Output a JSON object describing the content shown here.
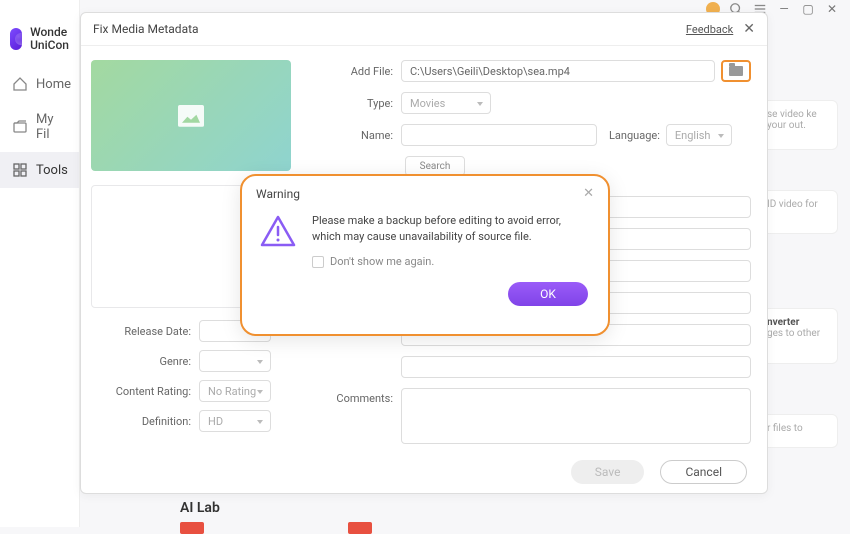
{
  "app": {
    "name_line1": "Wonde",
    "name_line2": "UniCon"
  },
  "sidebar": [
    {
      "label": "Home"
    },
    {
      "label": "My Fil"
    },
    {
      "label": "Tools"
    }
  ],
  "dialog": {
    "title": "Fix Media Metadata",
    "feedback": "Feedback",
    "labels": {
      "add_file": "Add File:",
      "type": "Type:",
      "name": "Name:",
      "language": "Language:",
      "release_date": "Release Date:",
      "genre": "Genre:",
      "content_rating": "Content Rating:",
      "definition": "Definition:",
      "comments": "Comments:"
    },
    "values": {
      "path": "C:\\Users\\Geili\\Desktop\\sea.mp4",
      "type": "Movies",
      "language": "English",
      "content_rating": "No Rating",
      "definition": "HD"
    },
    "buttons": {
      "search": "Search",
      "save": "Save",
      "cancel": "Cancel"
    }
  },
  "warning": {
    "title": "Warning",
    "text": "Please make a backup before editing to avoid error, which may cause unavailability of source file.",
    "dont_show": "Don't show me again.",
    "ok": "OK"
  },
  "bg": {
    "card1": "se video ke your out.",
    "card2": "ID video for",
    "card3_title": "nverter",
    "card3": "ges to other",
    "card4": "r files to",
    "section": "AI Lab"
  }
}
